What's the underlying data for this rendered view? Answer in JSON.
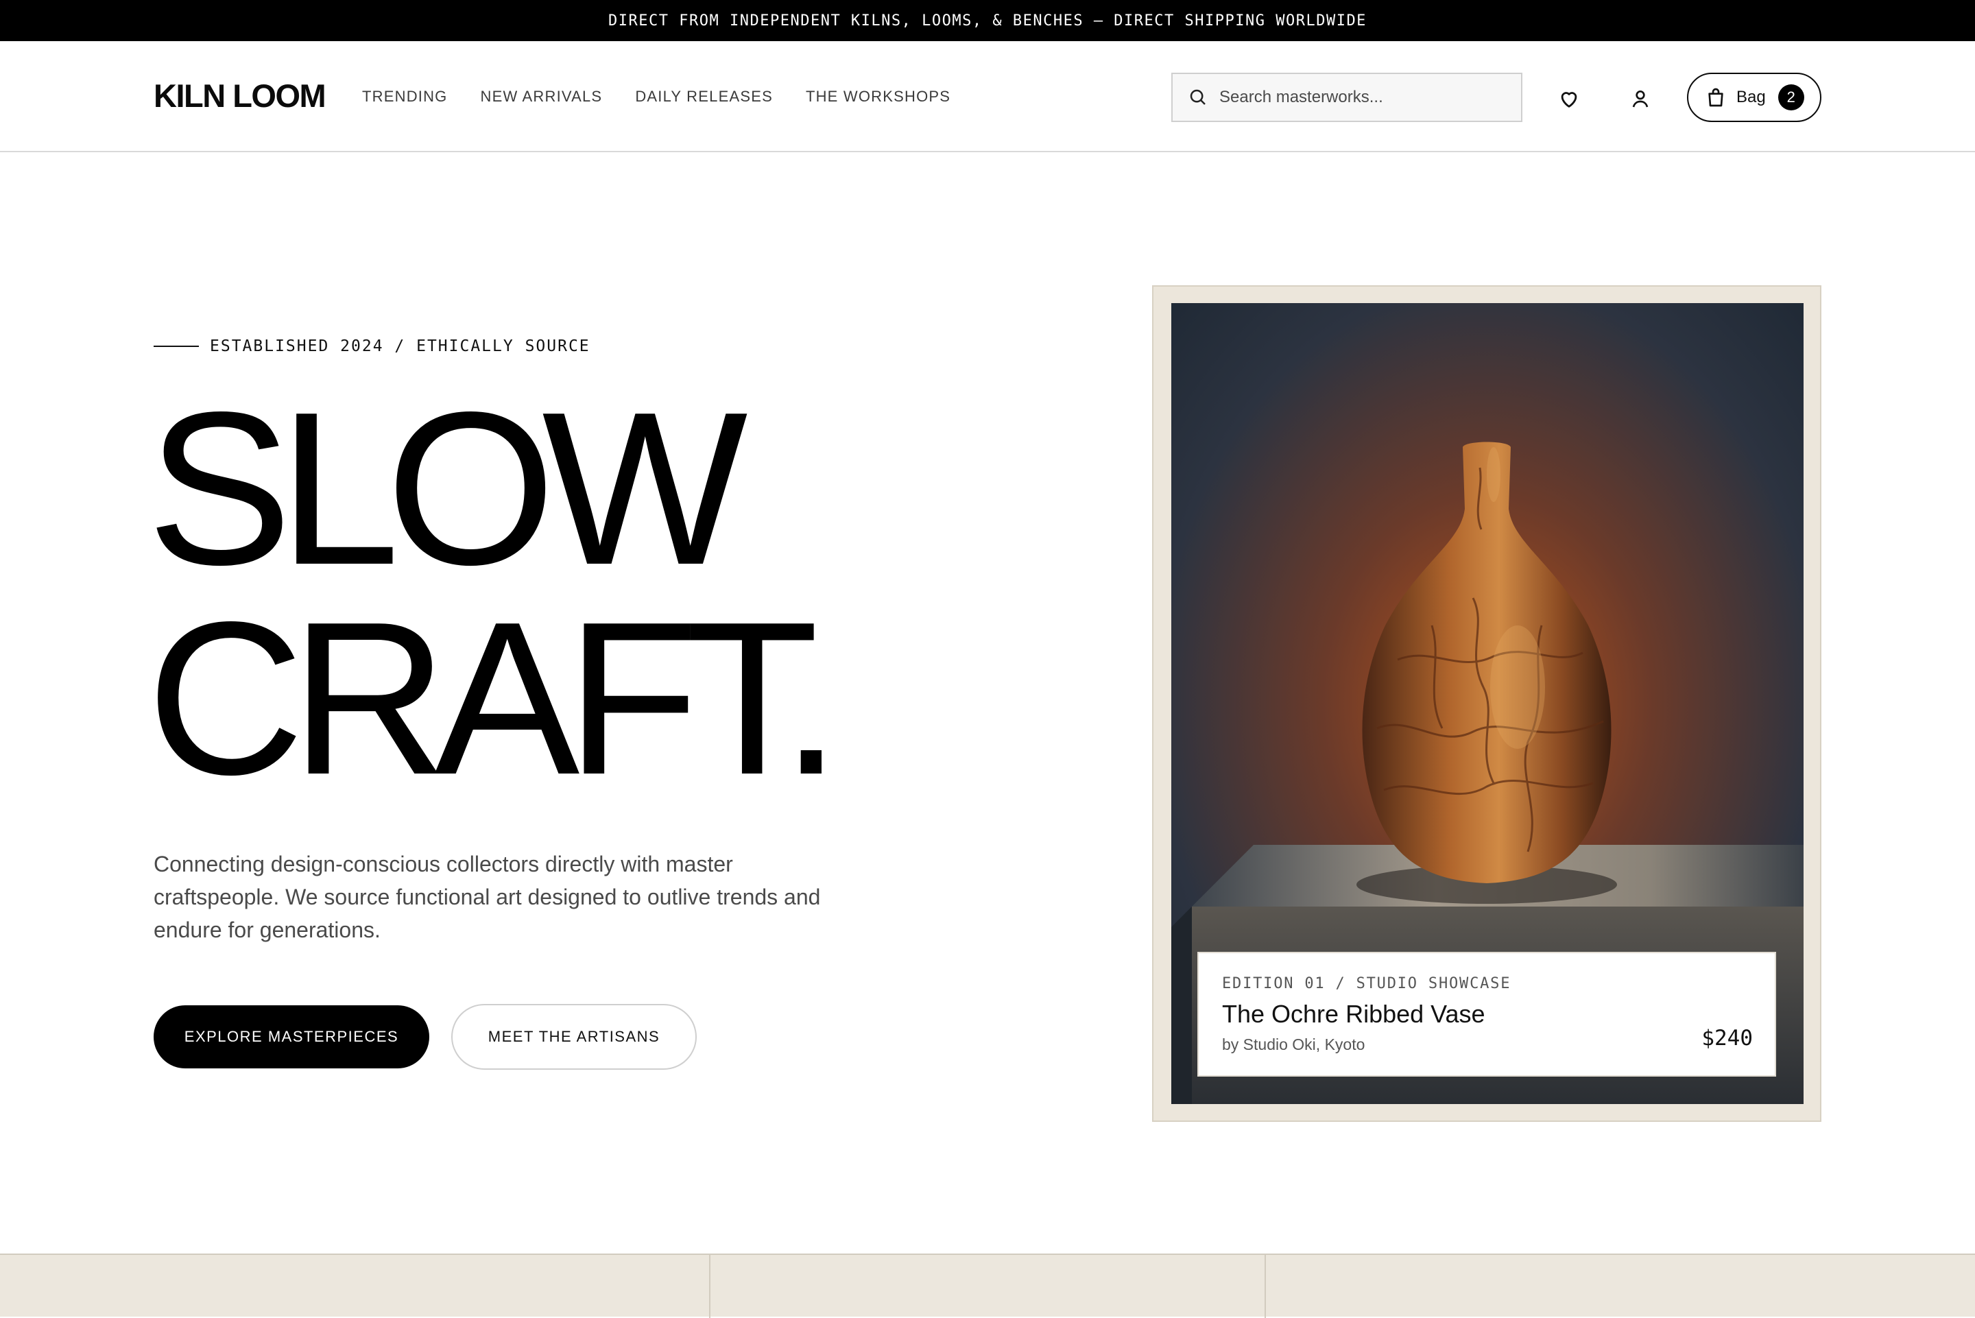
{
  "announcement": "DIRECT FROM INDEPENDENT KILNS, LOOMS, & BENCHES — DIRECT SHIPPING WORLDWIDE",
  "header": {
    "logo": "KILN LOOM",
    "nav": [
      "TRENDING",
      "NEW ARRIVALS",
      "DAILY RELEASES",
      "THE WORKSHOPS"
    ],
    "search_placeholder": "Search masterworks...",
    "bag_label": "Bag",
    "bag_count": "2",
    "icons": [
      "search-icon",
      "heart-icon",
      "user-icon",
      "shopping-bag-icon"
    ]
  },
  "hero": {
    "eyebrow": "ESTABLISHED 2024 / ETHICALLY SOURCE",
    "headline_line1": "SLOW",
    "headline_line2": "CRAFT.",
    "description": "Connecting design-conscious collectors directly with master craftspeople. We source functional art designed to outlive trends and endure for generations.",
    "primary_cta": "EXPLORE MASTERPIECES",
    "secondary_cta": "MEET THE ARTISANS"
  },
  "featured": {
    "eyebrow": "EDITION 01 / STUDIO SHOWCASE",
    "title": "The Ochre Ribbed Vase",
    "maker": "by Studio Oki, Kyoto",
    "price": "$240"
  },
  "colors": {
    "accent": "#000000",
    "frame": "#ece6db",
    "strip": "#ece7dd"
  }
}
